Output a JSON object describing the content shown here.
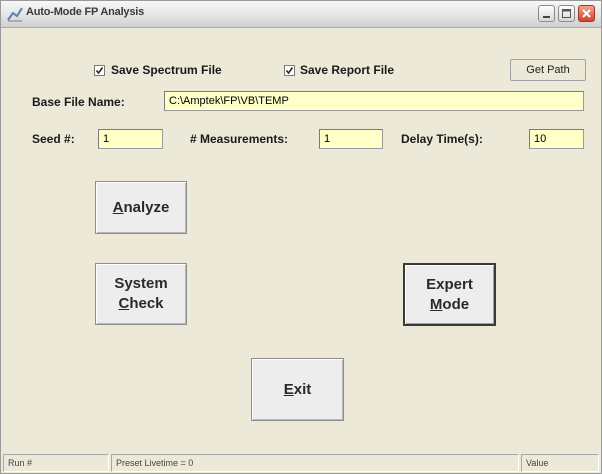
{
  "window": {
    "title": "Auto-Mode FP Analysis",
    "icon": "chart-trend-icon"
  },
  "options": {
    "save_spectrum_label": "Save Spectrum File",
    "save_spectrum_checked": true,
    "save_report_label": "Save Report File",
    "save_report_checked": true,
    "get_path_label": "Get Path"
  },
  "base_file": {
    "label": "Base File Name:",
    "value": "C:\\Amptek\\FP\\VB\\TEMP"
  },
  "params": {
    "seed_label": "Seed #:",
    "seed_value": "1",
    "measurements_label": "# Measurements:",
    "measurements_value": "1",
    "delay_label": "Delay Time(s):",
    "delay_value": "10"
  },
  "buttons": {
    "analyze": {
      "accel": "A",
      "rest": "nalyze"
    },
    "system_check": {
      "line1": "System",
      "accel": "C",
      "rest": "heck"
    },
    "expert_mode": {
      "line1": "Expert",
      "accel": "M",
      "rest": "ode"
    },
    "exit": {
      "accel": "E",
      "rest": "xit"
    }
  },
  "status": {
    "run": "Run #",
    "preset": "Preset Livetime = 0",
    "value": "Value"
  },
  "colors": {
    "field_bg": "#ffffc8",
    "window_bg": "#ece9d8"
  }
}
